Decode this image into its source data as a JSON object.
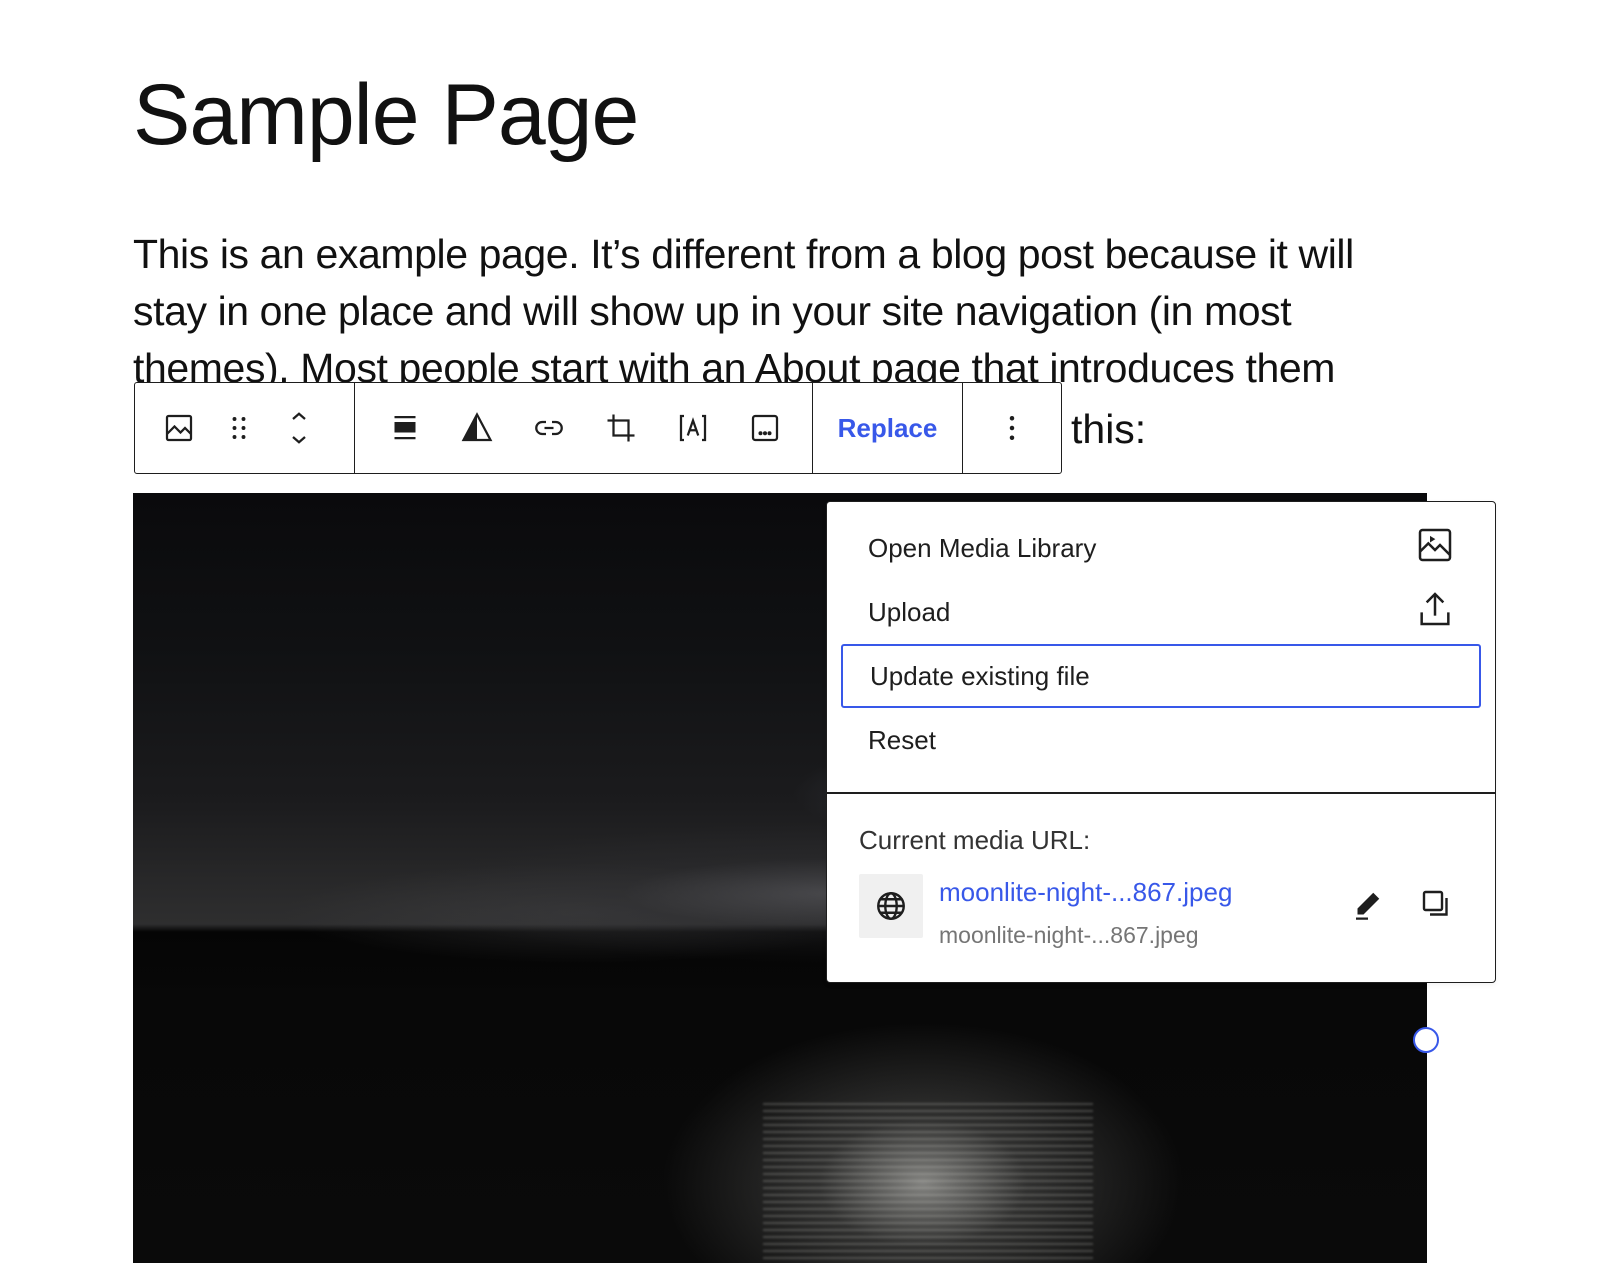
{
  "page": {
    "title": "Sample Page",
    "paragraph": "This is an example page. It’s different from a blog post because it will stay in one place and will show up in your site navigation (in most themes). Most people start with an About page that introduces them",
    "paragraph_tail": "this:"
  },
  "toolbar": {
    "replace_label": "Replace",
    "icons": [
      "image-icon",
      "drag-handle-icon",
      "move-up-down-icon",
      "align-icon",
      "duotone-icon",
      "link-icon",
      "crop-icon",
      "text-overlay-icon",
      "caption-icon",
      "more-options-icon"
    ]
  },
  "replace_menu": {
    "items": [
      {
        "label": "Open Media Library",
        "icon": "media-library-icon"
      },
      {
        "label": "Upload",
        "icon": "upload-icon"
      },
      {
        "label": "Update existing file",
        "icon": ""
      },
      {
        "label": "Reset",
        "icon": ""
      }
    ],
    "focused_item": "Update existing file",
    "current_url_heading": "Current media URL:",
    "url_link": "moonlite-night-...867.jpeg",
    "url_sub": "moonlite-night-...867.jpeg"
  },
  "colors": {
    "accent": "#3858e9",
    "text": "#111111",
    "border": "#1e1e1e"
  }
}
